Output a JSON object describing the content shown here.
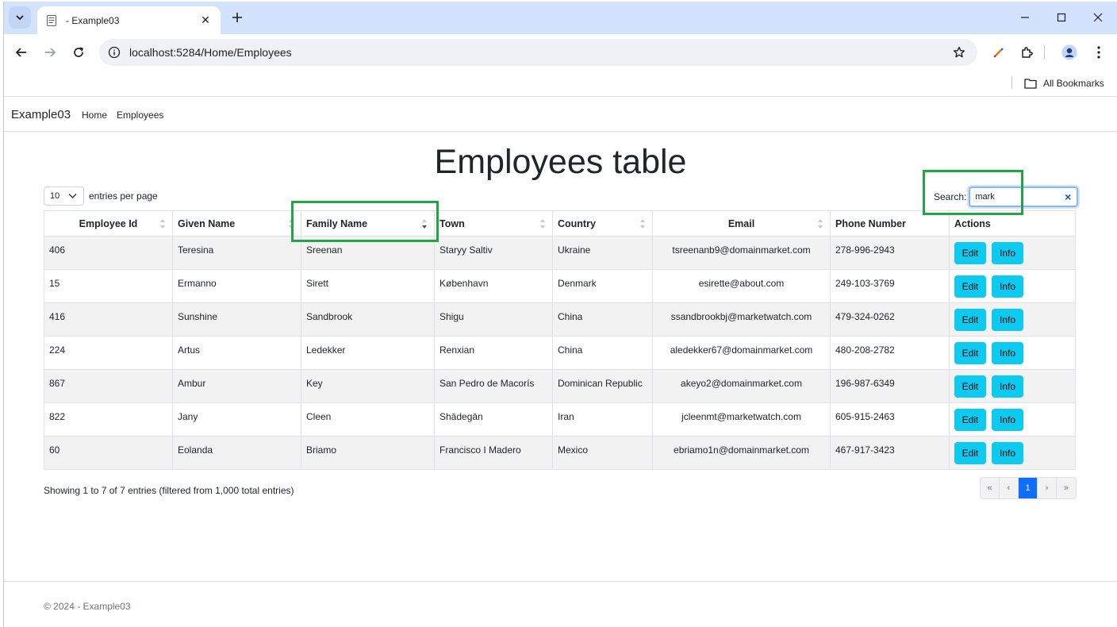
{
  "browser": {
    "tab_title": "- Example03",
    "url": "localhost:5284/Home/Employees",
    "all_bookmarks": "All Bookmarks"
  },
  "nav": {
    "brand": "Example03",
    "links": [
      "Home",
      "Employees"
    ]
  },
  "page": {
    "title": "Employees table",
    "per_page_value": "10",
    "per_page_label": "entries per page",
    "search_label": "Search:",
    "search_value": "mark"
  },
  "table": {
    "headers": [
      "Employee Id",
      "Given Name",
      "Family Name",
      "Town",
      "Country",
      "Email",
      "Phone Number",
      "Actions"
    ],
    "rows": [
      [
        "406",
        "Teresina",
        "Sreenan",
        "Staryy Saltiv",
        "Ukraine",
        "tsreenanb9@domainmarket.com",
        "278-996-2943"
      ],
      [
        "15",
        "Ermanno",
        "Sirett",
        "København",
        "Denmark",
        "esirette@about.com",
        "249-103-3769"
      ],
      [
        "416",
        "Sunshine",
        "Sandbrook",
        "Shigu",
        "China",
        "ssandbrookbj@marketwatch.com",
        "479-324-0262"
      ],
      [
        "224",
        "Artus",
        "Ledekker",
        "Renxian",
        "China",
        "aledekker67@domainmarket.com",
        "480-208-2782"
      ],
      [
        "867",
        "Ambur",
        "Key",
        "San Pedro de Macorís",
        "Dominican Republic",
        "akeyo2@domainmarket.com",
        "196-987-6349"
      ],
      [
        "822",
        "Jany",
        "Cleen",
        "Shādegān",
        "Iran",
        "jcleenmt@marketwatch.com",
        "605-915-2463"
      ],
      [
        "60",
        "Eolanda",
        "Briamo",
        "Francisco I Madero",
        "Mexico",
        "ebriamo1n@domainmarket.com",
        "467-917-3423"
      ]
    ],
    "edit_label": "Edit",
    "info_label": "Info"
  },
  "footer_info": {
    "showing": "Showing 1 to 7 of 7 entries (filtered from 1,000 total entries)",
    "pager": [
      "«",
      "‹",
      "1",
      "›",
      "»"
    ],
    "copyright": "© 2024 - Example03"
  },
  "colors": {
    "tab_strip": "#d3e3fd",
    "button_info": "#0dcaf0",
    "pager_active": "#0d6efd",
    "highlight": "#22a547"
  }
}
